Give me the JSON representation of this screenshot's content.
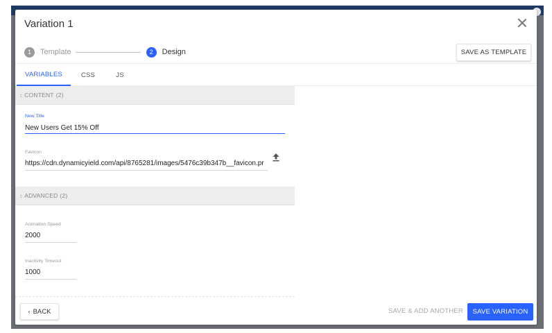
{
  "modal": {
    "title": "Variation 1"
  },
  "stepper": {
    "steps": [
      {
        "number": "1",
        "label": "Template"
      },
      {
        "number": "2",
        "label": "Design"
      }
    ]
  },
  "toolbar": {
    "save_as_template_label": "SAVE AS TEMPLATE"
  },
  "tabs": [
    {
      "label": "VARIABLES",
      "active": true
    },
    {
      "label": "CSS",
      "active": false
    },
    {
      "label": "JS",
      "active": false
    }
  ],
  "sections": {
    "content": {
      "title": "CONTENT",
      "count": "(2)",
      "fields": {
        "new_title": {
          "label": "New Title",
          "value": "New Users Get 15% Off"
        },
        "favicon": {
          "label": "Favicon",
          "value": "https://cdn.dynamicyield.com/api/8765281/images/5476c39b347b__favicon.pr"
        }
      }
    },
    "advanced": {
      "title": "ADVANCED",
      "count": "(2)",
      "fields": {
        "animation_speed": {
          "label": "Animation Speed",
          "value": "2000"
        },
        "inactivity_timeout": {
          "label": "Inactivity Timeout",
          "value": "1000"
        }
      }
    }
  },
  "footer": {
    "back_label": "BACK",
    "save_add_another_label": "SAVE & ADD ANOTHER",
    "save_variation_label": "SAVE VARIATION"
  },
  "colors": {
    "accent": "#2962ff",
    "section_bg": "#ededed"
  }
}
